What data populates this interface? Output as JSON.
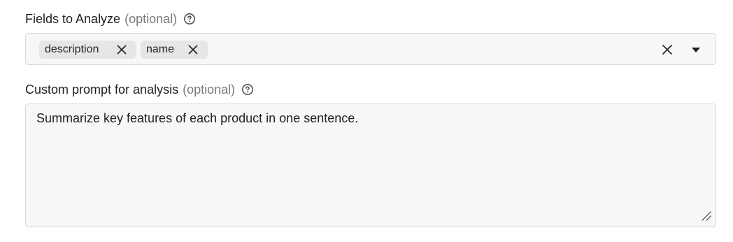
{
  "fields": {
    "label": "Fields to Analyze",
    "optional": "(optional)",
    "help_icon": "help-circle-icon",
    "chips": [
      {
        "label": "description",
        "remove_icon": "close-icon"
      },
      {
        "label": "name",
        "remove_icon": "close-icon"
      }
    ],
    "clear_icon": "close-icon",
    "dropdown_icon": "caret-down-icon"
  },
  "prompt": {
    "label": "Custom prompt for analysis",
    "optional": "(optional)",
    "help_icon": "help-circle-icon",
    "value": "Summarize key features of each product in one sentence.",
    "resize_icon": "resize-handle-icon"
  },
  "colors": {
    "text": "#1f1f1f",
    "muted": "#7a7a7a",
    "chip_bg": "#e6e6e6",
    "input_bg": "#f7f7f7",
    "border": "#d6d6d6"
  }
}
